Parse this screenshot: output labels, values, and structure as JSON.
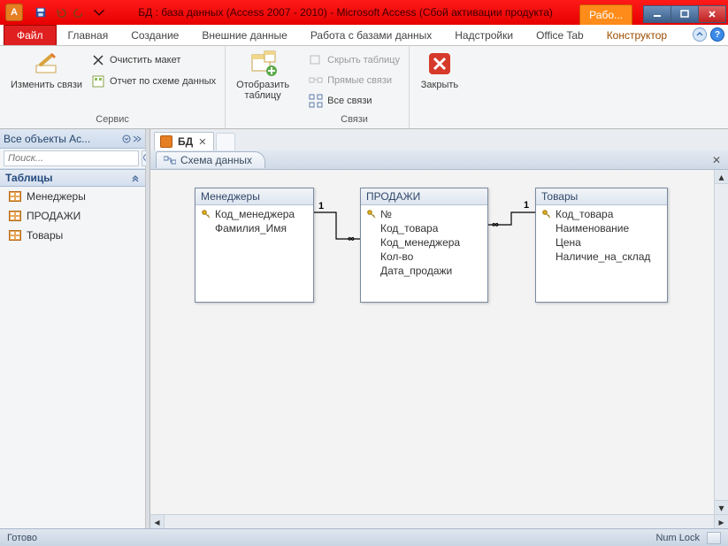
{
  "title": "БД : база данных (Access 2007 - 2010)  -  Microsoft Access (Сбой активации продукта)",
  "context_tab": "Рабо...",
  "ribbon_tabs": {
    "file": "Файл",
    "items": [
      "Главная",
      "Создание",
      "Внешние данные",
      "Работа с базами данных",
      "Надстройки",
      "Office Tab"
    ],
    "context": "Конструктор"
  },
  "ribbon": {
    "group1": {
      "label": "Сервис",
      "edit_rel": "Изменить связи",
      "clear_layout": "Очистить макет",
      "rel_report": "Отчет по схеме данных"
    },
    "group2": {
      "show_table": "Отобразить таблицу"
    },
    "group3": {
      "label": "Связи",
      "hide_table": "Скрыть таблицу",
      "direct_rel": "Прямые связи",
      "all_rel": "Все связи"
    },
    "group4": {
      "close": "Закрыть"
    }
  },
  "nav": {
    "header": "Все объекты Ac...",
    "search_placeholder": "Поиск...",
    "category": "Таблицы",
    "items": [
      "Менеджеры",
      "ПРОДАЖИ",
      "Товары"
    ]
  },
  "doc_tabs": {
    "bd": "БД"
  },
  "subtab": "Схема данных",
  "tables": {
    "t1": {
      "title": "Менеджеры",
      "f0": "Код_менеджера",
      "f1": "Фамилия_Имя"
    },
    "t2": {
      "title": "ПРОДАЖИ",
      "f0": "№",
      "f1": "Код_товара",
      "f2": "Код_менеджера",
      "f3": "Кол-во",
      "f4": "Дата_продажи"
    },
    "t3": {
      "title": "Товары",
      "f0": "Код_товара",
      "f1": "Наименование",
      "f2": "Цена",
      "f3": "Наличие_на_склад"
    }
  },
  "rel": {
    "one": "1",
    "many": "∞"
  },
  "status": {
    "left": "Готово",
    "numlock": "Num Lock"
  }
}
